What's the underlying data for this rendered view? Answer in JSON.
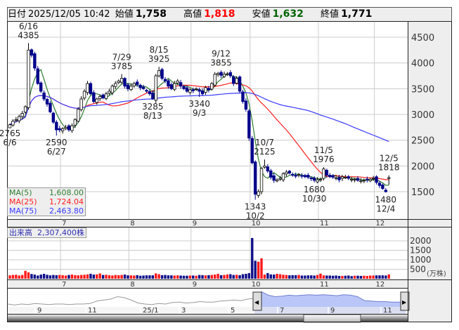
{
  "header": {
    "date_label": "日付",
    "datetime": "2025/12/05 10:42",
    "open_label": "始値",
    "open": "1,758",
    "high_label": "高値",
    "high": "1,818",
    "low_label": "安値",
    "low": "1,632",
    "close_label": "終値",
    "close": "1,771"
  },
  "legend": {
    "ma5_label": "MA(5)",
    "ma5_value": "1,608.00",
    "ma25_label": "MA(25)",
    "ma25_value": "1,724.04",
    "ma75_label": "MA(75)",
    "ma75_value": "2,463.80"
  },
  "volume_legend": {
    "label": "出来高",
    "value": "2,307,400株"
  },
  "volume_unit": "(万株)",
  "colors": {
    "up_fill": "#ffffff",
    "down_fill": "#00008b",
    "ma5": "#2e7d2e",
    "ma25": "#ff2020",
    "ma75": "#3a3aff",
    "vol_up": "#ff1a1a",
    "vol_down": "#10108a",
    "high": "#ff0000",
    "low": "#006400"
  },
  "chart_data": {
    "type": "candlestick",
    "price_axis": {
      "ticks": [
        "4500",
        "4000",
        "3500",
        "3000",
        "2500",
        "2000",
        "1500"
      ],
      "range": [
        1000,
        4820
      ]
    },
    "volume_axis": {
      "ticks": [
        "2000",
        "1500",
        "1000",
        "500"
      ],
      "range": [
        0,
        2800
      ]
    },
    "month_labels": [
      {
        "label": "7",
        "index": 17
      },
      {
        "label": "8",
        "index": 39
      },
      {
        "label": "9",
        "index": 59
      },
      {
        "label": "10",
        "index": 78
      },
      {
        "label": "11",
        "index": 100
      },
      {
        "label": "12",
        "index": 118
      }
    ],
    "closes": [
      2800,
      2870,
      2900,
      2960,
      3020,
      3150,
      4250,
      4150,
      3900,
      3600,
      3450,
      3300,
      3200,
      3050,
      2850,
      2700,
      2700,
      2720,
      2750,
      2700,
      2780,
      2900,
      3100,
      3300,
      3450,
      3600,
      3400,
      3250,
      3300,
      3350,
      3320,
      3400,
      3450,
      3550,
      3600,
      3650,
      3700,
      3550,
      3500,
      3550,
      3600,
      3580,
      3520,
      3500,
      3450,
      3400,
      3300,
      3750,
      3850,
      3700,
      3650,
      3550,
      3500,
      3600,
      3650,
      3550,
      3500,
      3450,
      3480,
      3460,
      3500,
      3450,
      3400,
      3520,
      3480,
      3600,
      3780,
      3800,
      3760,
      3780,
      3790,
      3750,
      3600,
      3700,
      3450,
      3250,
      3100,
      2540,
      2060,
      1450,
      1500,
      1950,
      2000,
      1900,
      1780,
      1720,
      1730,
      1760,
      1850,
      1880,
      1860,
      1820,
      1800,
      1830,
      1810,
      1790,
      1780,
      1750,
      1720,
      1730,
      1740,
      1940,
      1820,
      1790,
      1780,
      1770,
      1730,
      1790,
      1780,
      1760,
      1740,
      1740,
      1720,
      1710,
      1720,
      1730,
      1740,
      1760,
      1680,
      1620,
      1560,
      1500,
      1771
    ],
    "last_candle": {
      "open": 1758,
      "high": 1818,
      "low": 1632,
      "close": 1771
    },
    "volumes": [
      180,
      200,
      210,
      170,
      200,
      420,
      340,
      250,
      220,
      170,
      220,
      260,
      210,
      180,
      200,
      190,
      200,
      190,
      170,
      200,
      220,
      190,
      180,
      200,
      210,
      230,
      260,
      220,
      230,
      280,
      200,
      210,
      190,
      170,
      200,
      190,
      200,
      220,
      180,
      180,
      170,
      190,
      160,
      170,
      180,
      180,
      180,
      280,
      240,
      190,
      200,
      180,
      180,
      170,
      180,
      170,
      160,
      160,
      170,
      170,
      160,
      200,
      190,
      180,
      190,
      200,
      220,
      260,
      190,
      200,
      230,
      240,
      200,
      210,
      190,
      240,
      260,
      300,
      2150,
      950,
      900,
      1080,
      220,
      300,
      230,
      220,
      260,
      240,
      210,
      200,
      180,
      190,
      190,
      200,
      170,
      170,
      180,
      180,
      170,
      200,
      270,
      180,
      170,
      170,
      160,
      170,
      150,
      150,
      160,
      170,
      140,
      160,
      160,
      150,
      160,
      150,
      170,
      170,
      180,
      180,
      180,
      170,
      231
    ],
    "annotations": [
      {
        "date": "6/16",
        "value": "4385",
        "index": 6,
        "place": "above"
      },
      {
        "date": "6/6",
        "value": "2765",
        "index": 0,
        "place": "below"
      },
      {
        "date": "6/27",
        "value": "2590",
        "index": 15,
        "place": "below"
      },
      {
        "date": "7/29",
        "value": "3785",
        "index": 36,
        "place": "above"
      },
      {
        "date": "8/15",
        "value": "3925",
        "index": 48,
        "place": "above"
      },
      {
        "date": "8/13",
        "value": "3285",
        "index": 46,
        "place": "below"
      },
      {
        "date": "9/12",
        "value": "3855",
        "index": 68,
        "place": "above"
      },
      {
        "date": "9/3",
        "value": "3340",
        "index": 61,
        "place": "below"
      },
      {
        "date": "10/7",
        "value": "2125",
        "index": 82,
        "place": "above"
      },
      {
        "date": "10/2",
        "value": "1343",
        "index": 79,
        "place": "below"
      },
      {
        "date": "11/5",
        "value": "1976",
        "index": 101,
        "place": "above"
      },
      {
        "date": "10/30",
        "value": "1680",
        "index": 98,
        "place": "below"
      },
      {
        "date": "12/5",
        "value": "1818",
        "index": 122,
        "place": "above"
      },
      {
        "date": "12/4",
        "value": "1480",
        "index": 121,
        "place": "below"
      }
    ],
    "navigator": {
      "labels": [
        "9",
        "11",
        "25/1",
        "3",
        "5",
        "7",
        "9",
        "11"
      ],
      "series": [
        50,
        48,
        50,
        49,
        51,
        50,
        49,
        50,
        50,
        49,
        50,
        50,
        51,
        56,
        58,
        60,
        65,
        63,
        58,
        52,
        50,
        49,
        51,
        50,
        53,
        54,
        52,
        53,
        55,
        54,
        54,
        56,
        57,
        58,
        57,
        60,
        62,
        75,
        68,
        65,
        66,
        68,
        67,
        68,
        69,
        68,
        69,
        68,
        67,
        69,
        68,
        65,
        57,
        56,
        55,
        55,
        54,
        54,
        54
      ]
    }
  }
}
